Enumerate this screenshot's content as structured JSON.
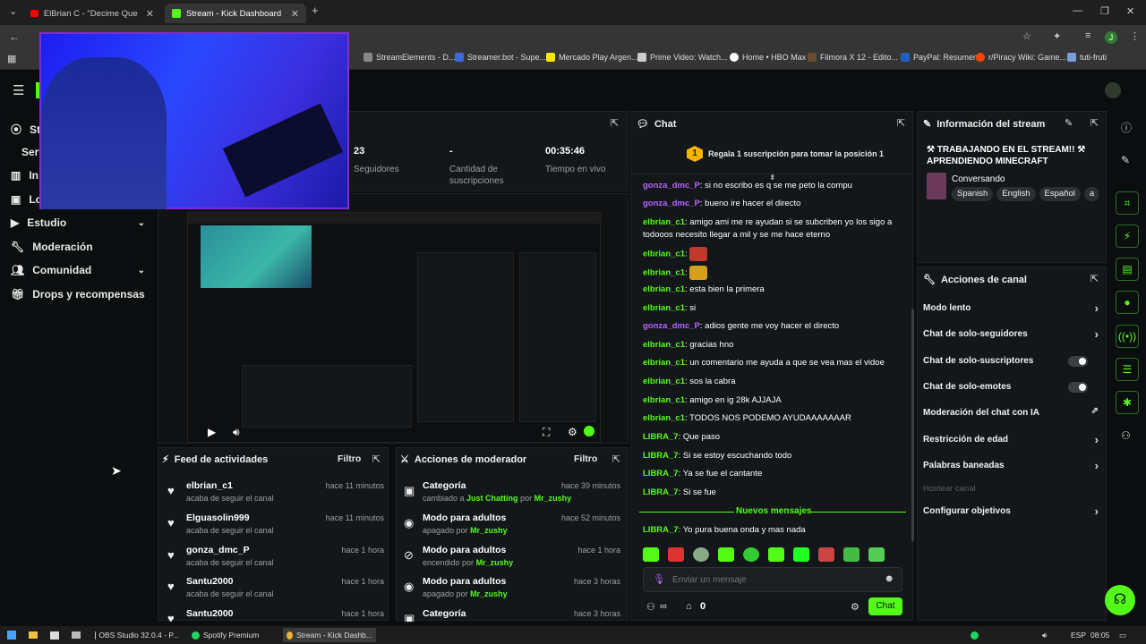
{
  "browser": {
    "tabs": [
      {
        "label": "ElBrian C - \"Decime Que Es\"",
        "icon": "youtube-icon"
      },
      {
        "label": "Stream - Kick Dashboard",
        "icon": "kick-icon"
      }
    ],
    "bookmarks": [
      "StreamElements - D...",
      "Streamer.bot - Supe...",
      "Mercado Play Argen...",
      "Prime Video: Watch...",
      "Home • HBO Max",
      "Filmora X 12 - Edito...",
      "PayPal: Resumen",
      "r/Piracy Wiki: Game...",
      "tuti-fruti"
    ],
    "profile_initial": "J"
  },
  "sidebar": {
    "items": [
      {
        "label": "St",
        "icon": "stream-icon"
      },
      {
        "label": "Serv"
      },
      {
        "label": "In",
        "icon": "chart-icon"
      },
      {
        "label": "Lo",
        "icon": "loot-icon"
      },
      {
        "label": "Estudio",
        "icon": "video-icon"
      },
      {
        "label": "Moderación",
        "icon": "wrench-icon"
      },
      {
        "label": "Comunidad",
        "icon": "community-icon"
      },
      {
        "label": "Drops y recompensas",
        "icon": "gift-icon"
      }
    ]
  },
  "stats": [
    {
      "value": "23",
      "label": "Seguidores"
    },
    {
      "value": "-",
      "label": "Cantidad de suscripciones"
    },
    {
      "value": "00:35:46",
      "label": "Tiempo en vivo"
    }
  ],
  "feed": {
    "title": "Feed de actividades",
    "filter": "Filtro",
    "items": [
      {
        "name": "elbrian_c1",
        "desc": "acaba de seguir el canal",
        "time": "hace 11 minutos"
      },
      {
        "name": "Elguasolin999",
        "desc": "acaba de seguir el canal",
        "time": "hace 11 minutos"
      },
      {
        "name": "gonza_dmc_P",
        "desc": "acaba de seguir el canal",
        "time": "hace 1 hora"
      },
      {
        "name": "Santu2000",
        "desc": "acaba de seguir el canal",
        "time": "hace 1 hora"
      },
      {
        "name": "Santu2000",
        "desc": "",
        "time": "hace 1 hora"
      }
    ]
  },
  "modactions": {
    "title": "Acciones de moderador",
    "filter": "Filtro",
    "items": [
      {
        "name": "Categoría",
        "pre": "cambiado a",
        "val": "Just Chatting",
        "mid": "por",
        "user": "Mr_zushy",
        "time": "hace 39 minutos",
        "icon": "category-icon"
      },
      {
        "name": "Modo para adultos",
        "pre": "apagado por",
        "val": "",
        "mid": "",
        "user": "Mr_zushy",
        "time": "hace 52 minutos",
        "icon": "eye-icon"
      },
      {
        "name": "Modo para adultos",
        "pre": "encendido por",
        "val": "",
        "mid": "",
        "user": "Mr_zushy",
        "time": "hace 1 hora",
        "icon": "eye-off-icon"
      },
      {
        "name": "Modo para adultos",
        "pre": "apagado por",
        "val": "",
        "mid": "",
        "user": "Mr_zushy",
        "time": "hace 3 horas",
        "icon": "eye-icon"
      },
      {
        "name": "Categoría",
        "pre": "",
        "val": "",
        "mid": "",
        "user": "",
        "time": "hace 3 horas",
        "icon": "category-icon"
      }
    ]
  },
  "chat": {
    "title": "Chat",
    "pinned": "Regala 1 suscripción para tomar la posición 1",
    "pinned_rank": "1",
    "messages": [
      {
        "user": "gonza_dmc_P",
        "color": "purple",
        "text": "si no escribo es q se me peto la compu"
      },
      {
        "user": "gonza_dmc_P",
        "color": "purple",
        "text": "bueno ire hacer el directo"
      },
      {
        "user": "elbrian_c1",
        "color": "green",
        "text": "amigo ami me re ayudan si se subcriben yo los sigo a"
      },
      {
        "user": "",
        "color": "",
        "text": "todooos necesito llegar a mil y se me hace eterno"
      },
      {
        "user": "elbrian_c1",
        "color": "green",
        "text": "",
        "emote": "#c0392b"
      },
      {
        "user": "elbrian_c1",
        "color": "green",
        "text": "",
        "emote": "#d4a017"
      },
      {
        "user": "elbrian_c1",
        "color": "green",
        "text": "esta bien la primera"
      },
      {
        "user": "elbrian_c1",
        "color": "green",
        "text": "si"
      },
      {
        "user": "gonza_dmc_P",
        "color": "purple",
        "text": "adios gente me voy hacer el directo"
      },
      {
        "user": "elbrian_c1",
        "color": "green",
        "text": "gracias hno"
      },
      {
        "user": "elbrian_c1",
        "color": "green",
        "text": "un comentario me ayuda a que se vea mas el vidoe"
      },
      {
        "user": "elbrian_c1",
        "color": "green",
        "text": "sos la cabra"
      },
      {
        "user": "elbrian_c1",
        "color": "green",
        "text": "amigo en ig 28k AJJAJA"
      },
      {
        "user": "elbrian_c1",
        "color": "green",
        "text": "TODOS NOS PODEMO AYUDAAAAAAAR"
      },
      {
        "user": "LIBRA_7",
        "color": "green",
        "text": "Que paso"
      },
      {
        "user": "LIBRA_7",
        "color": "green",
        "text": "Si se estoy escuchando todo"
      },
      {
        "user": "LIBRA_7",
        "color": "green",
        "text": "Ya se fue el cantante"
      },
      {
        "user": "LIBRA_7",
        "color": "green",
        "text": "Si se fue"
      }
    ],
    "new_messages": "Nuevos mensajes",
    "last": {
      "user": "LIBRA_7",
      "text": "Yo pura buena onda y mas nada"
    },
    "input_placeholder": "Enviar un mensaje",
    "send": "Chat",
    "viewers": "0",
    "users_icon": "∞"
  },
  "stream_info": {
    "title_label": "Información del stream",
    "stream_title": "⚒ TRABAJANDO EN EL STREAM!! ⚒ APRENDIENDO MINECRAFT",
    "category": "Conversando",
    "tags": [
      "Spanish",
      "English",
      "Español",
      "a"
    ]
  },
  "channel_actions": {
    "title": "Acciones de canal",
    "items": [
      {
        "label": "Modo lento",
        "kind": "arrow"
      },
      {
        "label": "Chat de solo-seguidores",
        "kind": "arrow"
      },
      {
        "label": "Chat de solo-suscriptores",
        "kind": "toggle"
      },
      {
        "label": "Chat de solo-emotes",
        "kind": "toggle"
      },
      {
        "label": "Moderación del chat con IA",
        "kind": "ext"
      },
      {
        "label": "Restricción de edad",
        "kind": "arrow"
      },
      {
        "label": "Palabras baneadas",
        "kind": "arrow"
      },
      {
        "label": "Hostear canal",
        "kind": "disabled"
      },
      {
        "label": "Configurar objetivos",
        "kind": "arrow"
      }
    ]
  },
  "taskbar": {
    "apps": [
      "OBS Studio 32.0.4 - P...",
      "Spotify Premium",
      "Stream - Kick Dashb..."
    ],
    "lang": "ESP",
    "time": "08:05"
  },
  "colors": {
    "accent": "#53fc18",
    "purple": "#b565ff"
  }
}
